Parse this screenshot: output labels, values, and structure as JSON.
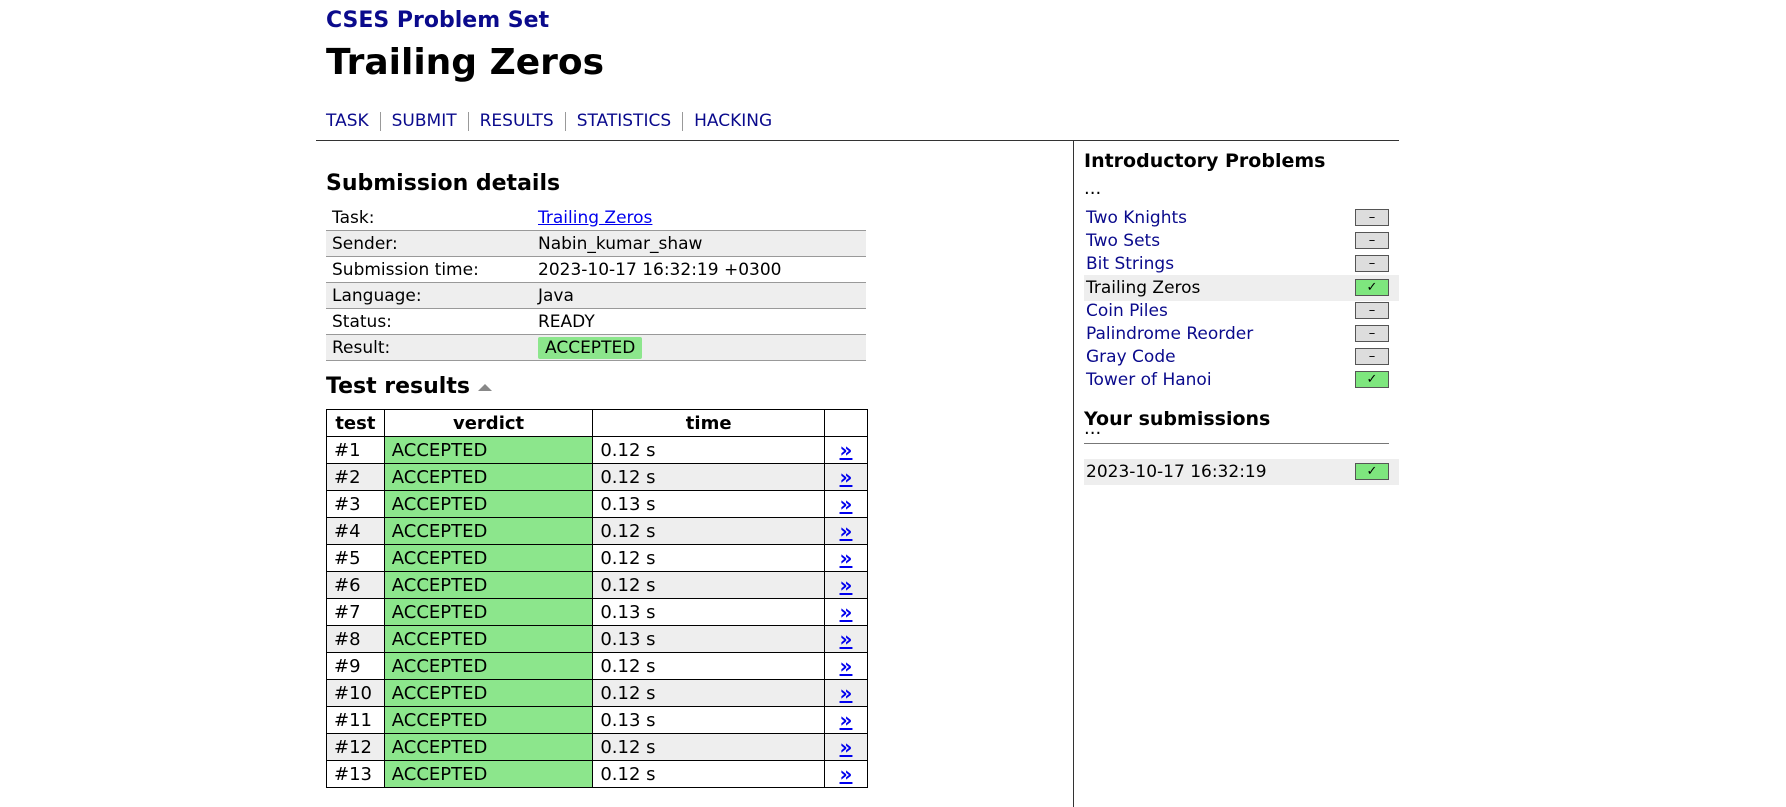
{
  "header": {
    "site_title": "CSES Problem Set",
    "task_title": "Trailing Zeros",
    "nav": [
      "TASK",
      "SUBMIT",
      "RESULTS",
      "STATISTICS",
      "HACKING"
    ]
  },
  "submission": {
    "heading": "Submission details",
    "rows": [
      {
        "label": "Task:",
        "value": "Trailing Zeros"
      },
      {
        "label": "Sender:",
        "value": "Nabin_kumar_shaw"
      },
      {
        "label": "Submission time:",
        "value": "2023-10-17 16:32:19 +0300"
      },
      {
        "label": "Language:",
        "value": "Java"
      },
      {
        "label": "Status:",
        "value": "READY"
      },
      {
        "label": "Result:",
        "value": "ACCEPTED"
      }
    ]
  },
  "tests": {
    "heading": "Test results",
    "columns": [
      "test",
      "verdict",
      "time"
    ],
    "link_glyph": "»",
    "rows": [
      {
        "test": "#1",
        "verdict": "ACCEPTED",
        "time": "0.12 s"
      },
      {
        "test": "#2",
        "verdict": "ACCEPTED",
        "time": "0.12 s"
      },
      {
        "test": "#3",
        "verdict": "ACCEPTED",
        "time": "0.13 s"
      },
      {
        "test": "#4",
        "verdict": "ACCEPTED",
        "time": "0.12 s"
      },
      {
        "test": "#5",
        "verdict": "ACCEPTED",
        "time": "0.12 s"
      },
      {
        "test": "#6",
        "verdict": "ACCEPTED",
        "time": "0.12 s"
      },
      {
        "test": "#7",
        "verdict": "ACCEPTED",
        "time": "0.13 s"
      },
      {
        "test": "#8",
        "verdict": "ACCEPTED",
        "time": "0.13 s"
      },
      {
        "test": "#9",
        "verdict": "ACCEPTED",
        "time": "0.12 s"
      },
      {
        "test": "#10",
        "verdict": "ACCEPTED",
        "time": "0.12 s"
      },
      {
        "test": "#11",
        "verdict": "ACCEPTED",
        "time": "0.13 s"
      },
      {
        "test": "#12",
        "verdict": "ACCEPTED",
        "time": "0.12 s"
      },
      {
        "test": "#13",
        "verdict": "ACCEPTED",
        "time": "0.12 s"
      }
    ]
  },
  "sidebar": {
    "section_title": "Introductory Problems",
    "ellipsis": "...",
    "problems": [
      {
        "name": "Two Knights",
        "status": "none",
        "current": false
      },
      {
        "name": "Two Sets",
        "status": "none",
        "current": false
      },
      {
        "name": "Bit Strings",
        "status": "none",
        "current": false
      },
      {
        "name": "Trailing Zeros",
        "status": "full",
        "current": true
      },
      {
        "name": "Coin Piles",
        "status": "none",
        "current": false
      },
      {
        "name": "Palindrome Reorder",
        "status": "none",
        "current": false
      },
      {
        "name": "Gray Code",
        "status": "none",
        "current": false
      },
      {
        "name": "Tower of Hanoi",
        "status": "full",
        "current": false
      }
    ],
    "status_glyphs": {
      "none": "–",
      "full": "✓"
    },
    "submissions_title": "Your submissions",
    "submissions": [
      {
        "time": "2023-10-17 16:32:19",
        "status": "full"
      }
    ]
  },
  "colors": {
    "link": "#0a0a8c",
    "accepted_bg": "#8ce68c",
    "row_alt": "#eeeeee"
  }
}
